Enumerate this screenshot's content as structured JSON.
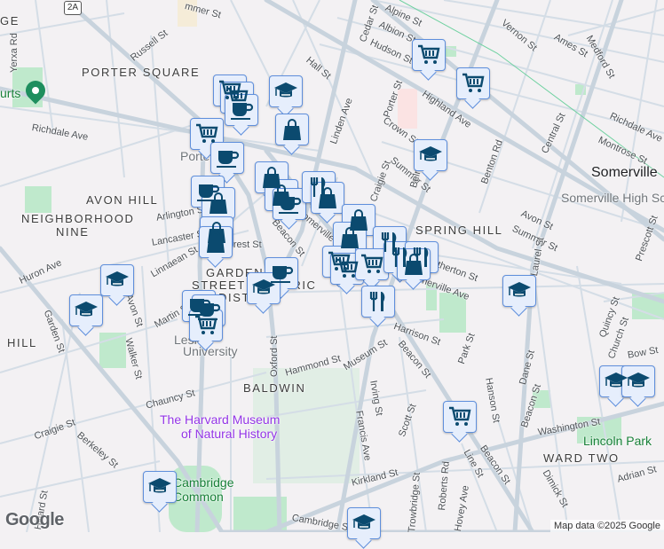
{
  "map": {
    "route_shield": "2A",
    "attribution": "Map data ©2025 Google",
    "logo": "Google",
    "colors": {
      "background": "#f3f1f3",
      "road": "#d4dde6",
      "major_road": "#c5d0da",
      "park": "#bfe9cc",
      "marker_fill": "#e6eefc",
      "marker_border": "#5f8fdc",
      "marker_icon": "#0b4a6f",
      "museum": "#9334e6",
      "park_text": "#188038"
    }
  },
  "labels": {
    "neighborhoods": [
      "PORTER SQUARE",
      "AVON HILL",
      "NEIGHBORHOOD",
      "NINE",
      "SPRING HILL",
      "GARDEN",
      "STREET HISTORIC",
      "DISTRICT",
      "BALDWIN",
      "WARD TWO",
      "HILL",
      "GE"
    ],
    "places": [
      "Somerville",
      "Somerville High Sc",
      "The Harvard Museum",
      "of Natural History",
      "Lincoln Park",
      "Lesley",
      "University",
      "Cambridge",
      "Common",
      "Porter",
      "urts"
    ],
    "streets": [
      "Russell St",
      "Richdale Ave",
      "Hall St",
      "Yerxa Rd",
      "Alpine St",
      "Albion St",
      "Hudson St",
      "Cedar St",
      "Highland Ave",
      "Porter St",
      "Crown St",
      "Summer St",
      "Summer St",
      "Craigie St",
      "Benton Rd",
      "Central St",
      "Medford St",
      "Vernon St",
      "Ames St",
      "Richdale Ave",
      "Montrose St",
      "Avon St",
      "Prescott St",
      "Laurel St",
      "Linden Ave",
      "Arlington St",
      "Lancaster St",
      "Linnaean St",
      "Huron Ave",
      "Garden St",
      "Avon St",
      "Walker St",
      "Martin St",
      "Chauncy St",
      "Craigie St",
      "Berkeley St",
      "Oxford St",
      "Hammond St",
      "Museum St",
      "Harrison St",
      "Beacon St",
      "Beacon St",
      "Beacon St",
      "Somerville Ave",
      "Somerville Ave",
      "Park St",
      "Dane St",
      "Irving St",
      "Francis Ave",
      "Scott St",
      "Hanson St",
      "Washington St",
      "Kirkland St",
      "Trowbridge St",
      "Roberts Rd",
      "Hovey Ave",
      "Line St",
      "Dimick St",
      "Adrian St",
      "Quincy St",
      "Church St",
      "Bow St",
      "Cambridge St",
      "Hillard St",
      "mmer St",
      "Belmont St",
      "Atherton St",
      "Beacon St",
      "Forest St"
    ]
  },
  "markers": [
    "cart",
    "cart",
    "coffee",
    "graduation-cap",
    "shopping-bag",
    "cart",
    "coffee",
    "shopping-bag",
    "shopping-bag",
    "coffee",
    "coffee",
    "shopping-bag",
    "shopping-bag",
    "shopping-bag",
    "restaurant",
    "shopping-bag",
    "shopping-bag",
    "restaurant",
    "shopping-bag",
    "cart",
    "cart",
    "cart",
    "restaurant",
    "restaurant",
    "shopping-bag",
    "coffee",
    "graduation-cap",
    "graduation-cap",
    "graduation-cap",
    "coffee",
    "coffee",
    "cart",
    "cart",
    "cart",
    "graduation-cap",
    "graduation-cap",
    "restaurant",
    "graduation-cap",
    "graduation-cap",
    "cart",
    "graduation-cap",
    "graduation-cap"
  ]
}
